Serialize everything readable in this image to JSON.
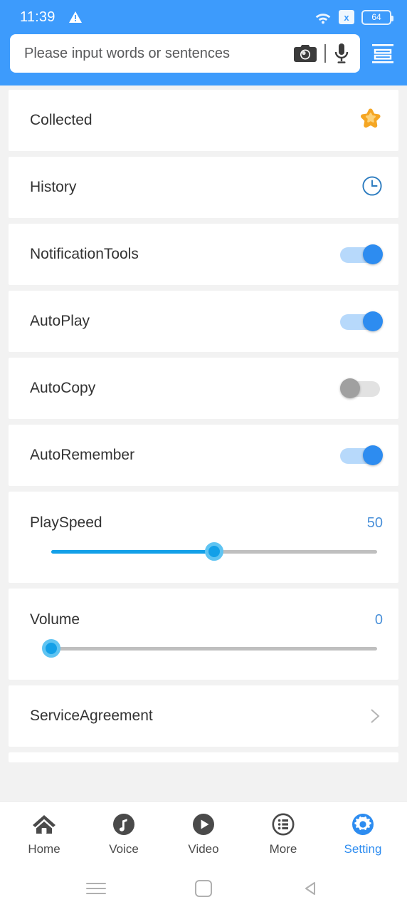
{
  "status_bar": {
    "time": "11:39",
    "warning_icon": "warning-triangle-icon",
    "wifi_icon": "wifi-icon",
    "sim_icon_label": "x",
    "battery_level": "64"
  },
  "header": {
    "search_placeholder": "Please input words or sentences",
    "search_value": "",
    "camera_icon": "camera-icon",
    "mic_icon": "microphone-icon",
    "menu_icon": "menu-list-icon"
  },
  "settings": {
    "rows": [
      {
        "label": "Collected",
        "type": "icon",
        "icon": "star-icon"
      },
      {
        "label": "History",
        "type": "icon",
        "icon": "clock-icon"
      },
      {
        "label": "NotificationTools",
        "type": "toggle",
        "state": "on"
      },
      {
        "label": "AutoPlay",
        "type": "toggle",
        "state": "on"
      },
      {
        "label": "AutoCopy",
        "type": "toggle",
        "state": "off"
      },
      {
        "label": "AutoRemember",
        "type": "toggle",
        "state": "on"
      }
    ],
    "sliders": [
      {
        "label": "PlaySpeed",
        "value": "50",
        "percent": 50,
        "min": 0,
        "max": 100
      },
      {
        "label": "Volume",
        "value": "0",
        "percent": 0,
        "min": 0,
        "max": 100
      }
    ],
    "link_row": {
      "label": "ServiceAgreement",
      "chevron": "chevron-right-icon"
    }
  },
  "tabbar": {
    "items": [
      {
        "label": "Home",
        "icon": "home-icon",
        "active": false
      },
      {
        "label": "Voice",
        "icon": "music-note-icon",
        "active": false
      },
      {
        "label": "Video",
        "icon": "play-circle-icon",
        "active": false
      },
      {
        "label": "More",
        "icon": "list-circle-icon",
        "active": false
      },
      {
        "label": "Setting",
        "icon": "gear-icon",
        "active": true
      }
    ]
  },
  "system_nav": {
    "recents_icon": "menu-recents-icon",
    "home_icon": "home-square-icon",
    "back_icon": "back-triangle-icon"
  },
  "colors": {
    "accent": "#3d9bfc",
    "toggle_on": "#2d8cf0",
    "slider": "#13a0e8",
    "star": "#f5a623",
    "background": "#f2f2f2"
  }
}
